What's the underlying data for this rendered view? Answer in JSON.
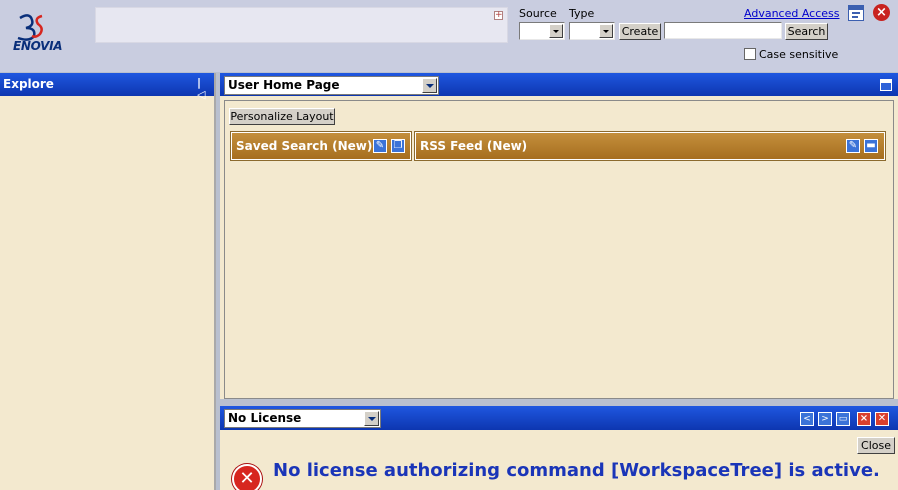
{
  "logo": {
    "mark": "3DS",
    "word": "ENOVIA"
  },
  "search": {
    "source_label": "Source",
    "type_label": "Type",
    "source_value": "",
    "type_value": "",
    "create_label": "Create",
    "search_value": "",
    "search_label": "Search",
    "advanced_label": "Advanced Access",
    "case_sensitive_label": "Case sensitive",
    "case_sensitive_checked": false
  },
  "explore": {
    "title": "Explore",
    "collapse_glyph": "|◁"
  },
  "main": {
    "view_select": "User Home Page",
    "personalize_label": "Personalize Layout",
    "portlets": [
      {
        "title": "Saved Search (New)"
      },
      {
        "title": "RSS Feed (New)"
      }
    ]
  },
  "bottom": {
    "view_select": "No License",
    "close_label": "Close",
    "message": "No license authorizing command [WorkspaceTree] is active."
  },
  "colors": {
    "header_blue": "#0d36b0",
    "panel_bg": "#f3e9cf",
    "portlet_gold": "#b47d2c",
    "message_blue": "#1a35b8",
    "error_red": "#d7261f"
  }
}
